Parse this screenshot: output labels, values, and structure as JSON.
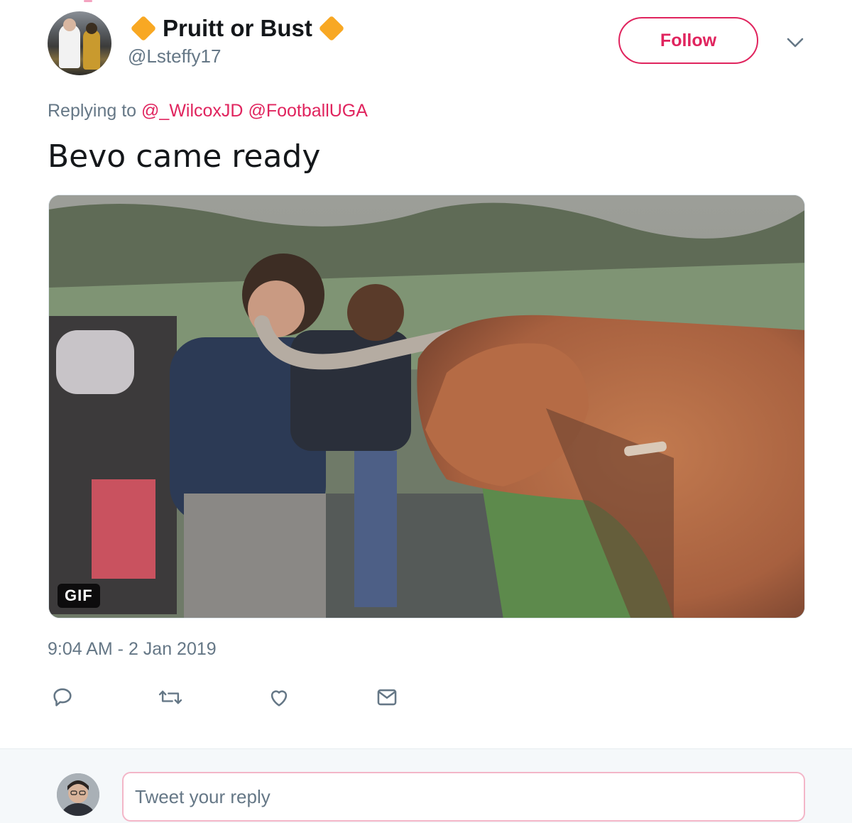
{
  "tweet": {
    "display_name": "Pruitt or Bust",
    "handle": "@Lsteffy17",
    "follow_label": "Follow",
    "replying_prefix": "Replying to",
    "mentions": [
      "@_WilcoxJD",
      "@FootballUGA"
    ],
    "text": "Bevo came ready",
    "media_badge": "GIF",
    "timestamp": "9:04 AM - 2 Jan 2019"
  },
  "actions": {
    "icons": [
      "reply-icon",
      "retweet-icon",
      "like-icon",
      "direct-message-icon"
    ]
  },
  "reply_box": {
    "placeholder": "Tweet your reply"
  },
  "colors": {
    "accent": "#e0245e",
    "muted": "#657786",
    "text": "#14171a",
    "diamond": "#f8a823",
    "reply_bg": "#f5f8fa"
  }
}
